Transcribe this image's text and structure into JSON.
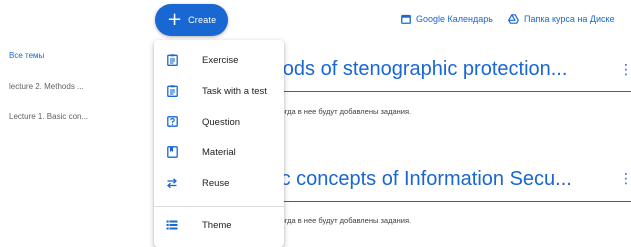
{
  "create_button": {
    "label": "Create"
  },
  "links": {
    "calendar": "Google Календарь",
    "drive": "Папка курса на Диске"
  },
  "sidebar": {
    "items": [
      {
        "label": "Все темы",
        "active": true
      },
      {
        "label": "lecture 2. Methods ..."
      },
      {
        "label": "Lecture 1. Basic con..."
      }
    ]
  },
  "topics": [
    {
      "title": "ethods of stenographic protection...",
      "empty_text": "у, когда в нее будут добавлены задания."
    },
    {
      "title": "asic concepts of Information Secu...",
      "empty_text": "у, когда в нее будут добавлены задания."
    }
  ],
  "menu": {
    "items": [
      {
        "label": "Exercise",
        "icon": "assignment-icon"
      },
      {
        "label": "Task with a test",
        "icon": "quiz-assignment-icon"
      },
      {
        "label": "Question",
        "icon": "question-icon"
      },
      {
        "label": "Material",
        "icon": "material-icon"
      },
      {
        "label": "Reuse",
        "icon": "reuse-icon"
      },
      {
        "label": "Theme",
        "icon": "theme-icon"
      }
    ]
  },
  "colors": {
    "accent": "#1967d2",
    "text": "#3c4043",
    "muted": "#5f6368"
  }
}
